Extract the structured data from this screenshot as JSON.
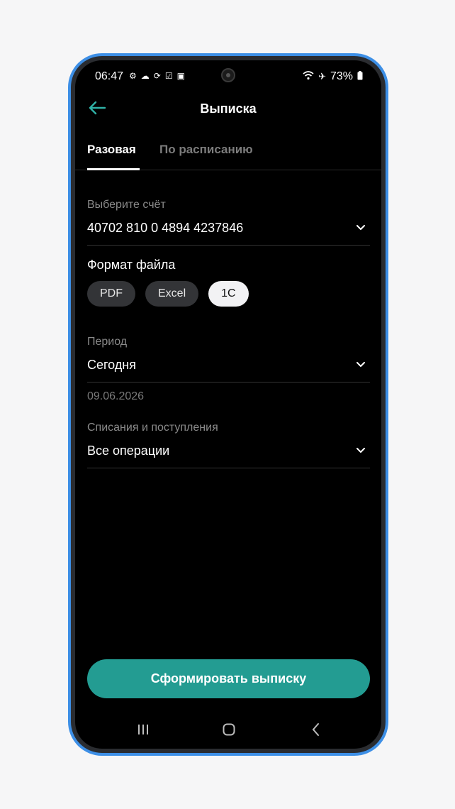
{
  "status_bar": {
    "time": "06:47",
    "battery": "73%",
    "left_icons": [
      "settings-icon",
      "cloud-icon",
      "sync-icon",
      "checkbox-icon",
      "gallery-icon"
    ],
    "right_icons": [
      "wifi-icon",
      "airplane-icon",
      "battery-icon"
    ]
  },
  "header": {
    "title": "Выписка"
  },
  "tabs": [
    {
      "label": "Разовая",
      "active": true
    },
    {
      "label": "По расписанию",
      "active": false
    }
  ],
  "account": {
    "label": "Выберите счёт",
    "value": "40702 810 0 4894 4237846"
  },
  "file_format": {
    "title": "Формат файла",
    "options": [
      "PDF",
      "Excel",
      "1C"
    ],
    "selected": "1C"
  },
  "period": {
    "label": "Период",
    "value": "Сегодня",
    "date": "09.06.2026"
  },
  "operations": {
    "label": "Списания и поступления",
    "value": "Все операции"
  },
  "submit_label": "Сформировать выписку",
  "colors": {
    "accent": "#239c92",
    "back_arrow": "#2fb1a6",
    "frame": "#3d8fe6"
  }
}
